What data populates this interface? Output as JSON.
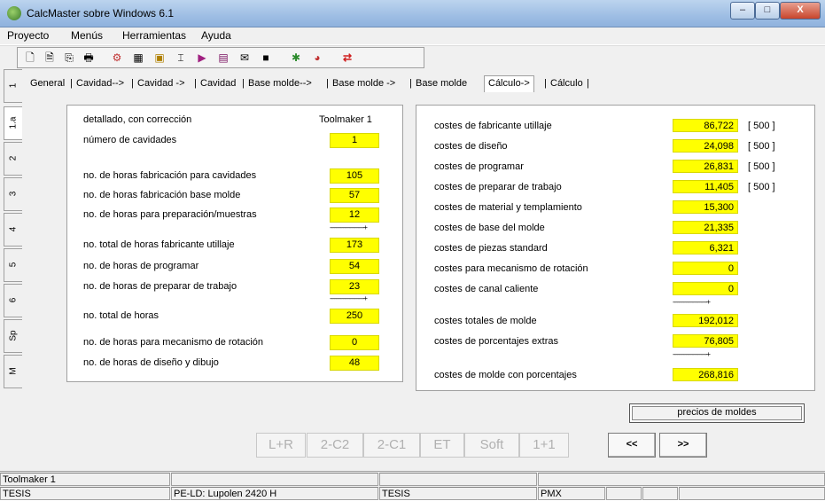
{
  "window": {
    "title": "CalcMaster sobre Windows 6.1",
    "minimize": "–",
    "maximize": "□",
    "close": "X"
  },
  "menu": [
    "Proyecto",
    "Menús",
    "Herramientas",
    "Ayuda"
  ],
  "toolbar": {
    "icons": [
      "new-icon",
      "open-icon",
      "copy-icon",
      "print-icon",
      "gear-chart-icon",
      "grid-icon",
      "module-icon",
      "align-icon",
      "export-icon",
      "table-icon",
      "envelope-icon",
      "square-icon",
      "bug-icon",
      "globe-icon",
      "swap-icon"
    ],
    "glyphs": [
      "🗋",
      "🗎",
      "⎘",
      "🖶",
      "⚙",
      "▦",
      "▣",
      "⌶",
      "▶",
      "▤",
      "✉",
      "■",
      "✱",
      "◕",
      "⇄"
    ]
  },
  "vtabs": [
    "1",
    "1.a",
    "2",
    "3",
    "4",
    "5",
    "6",
    "Sp",
    "M"
  ],
  "tabs": [
    "General",
    "Cavidad-->",
    "Cavidad ->",
    "Cavidad",
    "Base molde-->",
    "Base molde ->",
    "Base molde",
    "Cálculo->",
    "Cálculo"
  ],
  "active_tab": "Cálculo->",
  "left": {
    "header_left": "detallado, con corrección",
    "header_right": "Toolmaker 1",
    "rows": [
      {
        "label": "número de cavidades",
        "value": "1"
      },
      {
        "label": "no. de horas fabricación para cavidades",
        "value": "105"
      },
      {
        "label": "no. de horas fabricación base molde",
        "value": "57"
      },
      {
        "label": "no. de horas para preparación/muestras",
        "value": "12"
      },
      {
        "label": "no. total de horas fabricante utillaje",
        "value": "173"
      },
      {
        "label": "no. de horas de programar",
        "value": "54"
      },
      {
        "label": "no. de horas de preparar de trabajo",
        "value": "23"
      },
      {
        "label": "no. total de horas",
        "value": "250"
      },
      {
        "label": "no. de horas para mecanismo de rotación",
        "value": "0"
      },
      {
        "label": "no. de horas de diseño y dibujo",
        "value": "48"
      }
    ]
  },
  "right": {
    "rows": [
      {
        "label": "costes de fabricante utillaje",
        "value": "86,722",
        "note": "[ 500 ]"
      },
      {
        "label": "costes de diseño",
        "value": "24,098",
        "note": "[ 500 ]"
      },
      {
        "label": "costes de programar",
        "value": "26,831",
        "note": "[ 500 ]"
      },
      {
        "label": "costes de preparar de trabajo",
        "value": "11,405",
        "note": "[ 500 ]"
      },
      {
        "label": "costes de material y templamiento",
        "value": "15,300",
        "note": ""
      },
      {
        "label": "costes de base del molde",
        "value": "21,335",
        "note": ""
      },
      {
        "label": "costes de piezas standard",
        "value": "6,321",
        "note": ""
      },
      {
        "label": "costes para mecanismo de rotación",
        "value": "0",
        "note": ""
      },
      {
        "label": "costes de canal caliente",
        "value": "0",
        "note": ""
      },
      {
        "label": "costes totales de molde",
        "value": "192,012",
        "note": ""
      },
      {
        "label": "costes de porcentajes extras",
        "value": "76,805",
        "note": ""
      },
      {
        "label": "costes de molde con porcentajes",
        "value": "268,816",
        "note": ""
      }
    ],
    "price_button": "precios de moldes"
  },
  "dots": "-----------------------+",
  "bottom_buttons": [
    "L+R",
    "2-C2",
    "2-C1",
    "ET",
    "Soft",
    "1+1"
  ],
  "nav": {
    "prev": "<<",
    "next": ">>"
  },
  "status": {
    "row1": [
      "Toolmaker 1"
    ],
    "row2": [
      "TESIS",
      "PE-LD: Lupolen 2420 H",
      "TESIS",
      "PMX"
    ]
  }
}
